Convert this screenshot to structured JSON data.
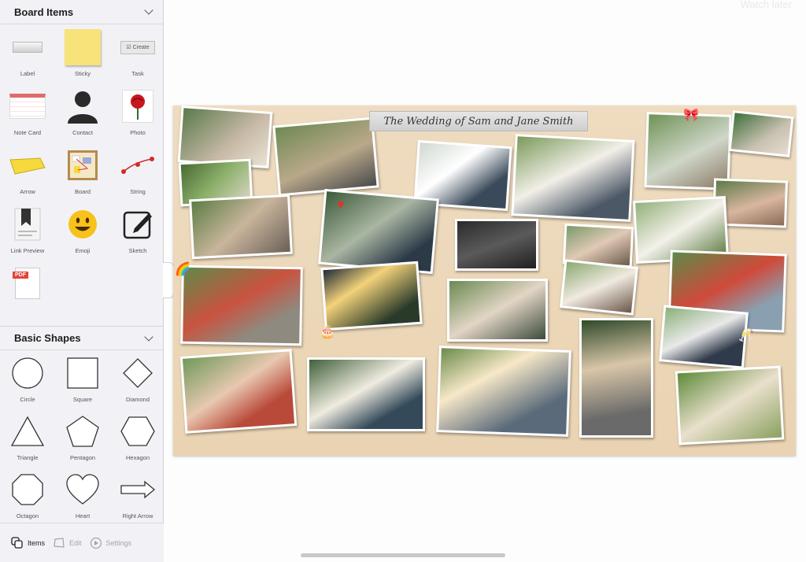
{
  "app": {
    "watch_later": "Watch later"
  },
  "sidebar": {
    "board_items": {
      "title": "Board Items",
      "items": [
        {
          "label": "Label",
          "icon": "label-icon"
        },
        {
          "label": "Sticky",
          "icon": "sticky-note-icon"
        },
        {
          "label": "Task",
          "icon": "task-icon",
          "inner_text": "Create"
        },
        {
          "label": "Note Card",
          "icon": "note-card-icon"
        },
        {
          "label": "Contact",
          "icon": "contact-icon"
        },
        {
          "label": "Photo",
          "icon": "photo-icon"
        },
        {
          "label": "Arrow",
          "icon": "arrow-item-icon"
        },
        {
          "label": "Board",
          "icon": "board-icon"
        },
        {
          "label": "String",
          "icon": "string-icon"
        },
        {
          "label": "Link Preview",
          "icon": "link-preview-icon"
        },
        {
          "label": "Emoji",
          "icon": "emoji-icon"
        },
        {
          "label": "Sketch",
          "icon": "sketch-icon"
        },
        {
          "label": "PDF",
          "icon": "pdf-icon",
          "inner_text": "PDF"
        }
      ]
    },
    "basic_shapes": {
      "title": "Basic Shapes",
      "items": [
        {
          "label": "Circle",
          "icon": "circle-icon"
        },
        {
          "label": "Square",
          "icon": "square-icon"
        },
        {
          "label": "Diamond",
          "icon": "diamond-icon"
        },
        {
          "label": "Triangle",
          "icon": "triangle-icon"
        },
        {
          "label": "Pentagon",
          "icon": "pentagon-icon"
        },
        {
          "label": "Hexagon",
          "icon": "hexagon-icon"
        },
        {
          "label": "Octagon",
          "icon": "octagon-icon"
        },
        {
          "label": "Heart",
          "icon": "heart-icon"
        },
        {
          "label": "Right Arrow",
          "icon": "right-arrow-icon"
        }
      ]
    },
    "tabs": [
      {
        "label": "Items",
        "icon": "items-icon",
        "active": true
      },
      {
        "label": "Edit",
        "icon": "edit-icon",
        "active": false
      },
      {
        "label": "Settings",
        "icon": "settings-icon",
        "active": false
      }
    ]
  },
  "board": {
    "title": "The Wedding of Sam and Jane Smith",
    "background_color": "#ecd8b8"
  },
  "colors": {
    "accent": "#1d1d1f",
    "inactive": "#a3a3a8",
    "board_frame": "#e9d3b2"
  }
}
